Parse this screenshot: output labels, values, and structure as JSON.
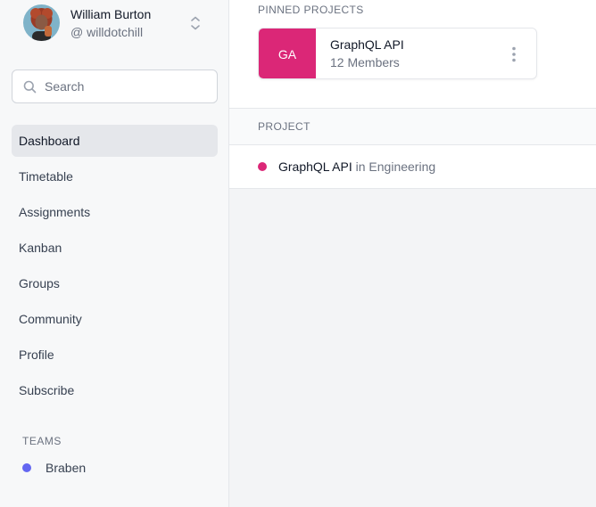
{
  "user": {
    "name": "William Burton",
    "handle": "@ willdotchill",
    "avatar_icon": "user-avatar"
  },
  "search": {
    "placeholder": "Search",
    "value": ""
  },
  "nav": {
    "items": [
      {
        "label": "Dashboard",
        "active": true
      },
      {
        "label": "Timetable",
        "active": false
      },
      {
        "label": "Assignments",
        "active": false
      },
      {
        "label": "Kanban",
        "active": false
      },
      {
        "label": "Groups",
        "active": false
      },
      {
        "label": "Community",
        "active": false
      },
      {
        "label": "Profile",
        "active": false
      },
      {
        "label": "Subscribe",
        "active": false
      }
    ]
  },
  "teams": {
    "heading": "TEAMS",
    "items": [
      {
        "label": "Braben",
        "color": "#6366f1"
      }
    ]
  },
  "pinned": {
    "heading": "PINNED PROJECTS",
    "projects": [
      {
        "initials": "GA",
        "name": "GraphQL API",
        "members": "12 Members",
        "color": "#db2777"
      }
    ]
  },
  "projects": {
    "header": "PROJECT",
    "rows": [
      {
        "name": "GraphQL API",
        "team_text": "in Engineering",
        "color": "#db2777"
      }
    ]
  }
}
